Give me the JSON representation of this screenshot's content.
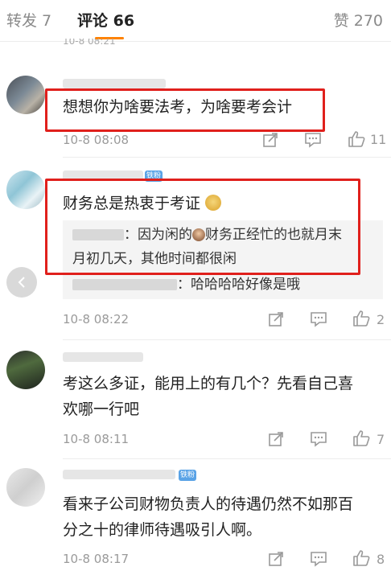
{
  "tabs": {
    "repost": "转发 7",
    "comments": "评论 66",
    "likes": "赞 270"
  },
  "colors": {
    "accent": "#ff8200",
    "highlight": "#e0201c",
    "fan_badge": "#5aa3e6"
  },
  "comments": [
    {
      "text": "想想你为啥要法考，为啥要考会计",
      "time": "10-8 08:08",
      "likes": "11"
    },
    {
      "text": "财务总是热衷于考证",
      "reply_1": "：因为闲的",
      "reply_1b": "财务正经忙的也就月末",
      "reply_1c": "月初几天，其他时间都很闲",
      "reply_2": "：哈哈哈哈好像是哦",
      "time": "10-8 08:22",
      "likes": "2"
    },
    {
      "text_line1": "考这么多证，能用上的有几个？先看自己喜",
      "text_line2": "欢哪一行吧",
      "time": "10-8 08:11",
      "likes": "7"
    },
    {
      "text_line1": "看来子公司财物负责人的待遇仍然不如那百",
      "text_line2": "分之十的律师待遇吸引人啊。",
      "time": "10-8 08:17",
      "likes": "8"
    }
  ],
  "badges": {
    "fan": "铁粉"
  },
  "icons": {
    "repost": "share-icon",
    "comment": "comment-icon",
    "like": "thumbs-up-icon",
    "back": "chevron-left-icon"
  }
}
